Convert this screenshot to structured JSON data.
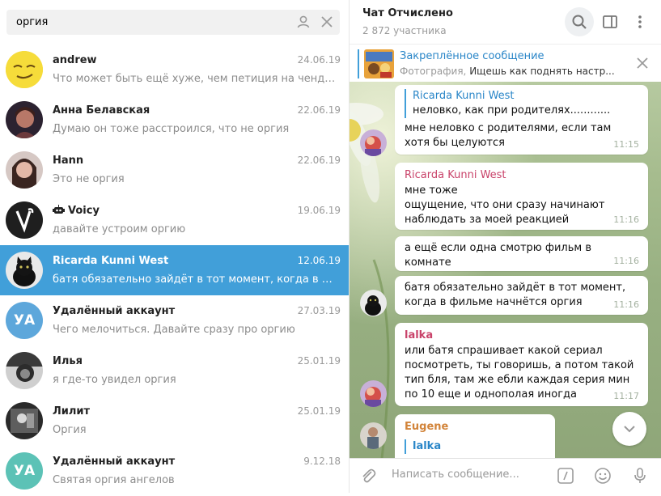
{
  "search": {
    "value": "оргия"
  },
  "chats": [
    {
      "name": "andrew",
      "date": "24.06.19",
      "preview": "Что может быть ещё хуже, чем петиция на чендж .орг)))",
      "avatar_color": "#f2d230",
      "active": false
    },
    {
      "name": "Анна Белавская",
      "date": "22.06.19",
      "preview": "Думаю он тоже расстроился, что не оргия",
      "avatar_color": "#3a2e35",
      "active": false
    },
    {
      "name": "Hann",
      "date": "22.06.19",
      "preview": "Это не оргия",
      "avatar_color": "#a98a86",
      "active": false
    },
    {
      "name": "Voicy",
      "date": "19.06.19",
      "preview": "давайте устроим оргию",
      "avatar_color": "#222222",
      "active": false,
      "bot": true
    },
    {
      "name": "Ricarda Kunni West",
      "date": "12.06.19",
      "preview": "батя обязательно зайдёт в тот момент, когда в фильме начнётся оргия",
      "avatar_color": "#eaeaea",
      "active": true
    },
    {
      "name": "Удалённый аккаунт",
      "date": "27.03.19",
      "preview": "Чего мелочиться. Давайте сразу про оргию",
      "avatar_color": "#5da7db",
      "initials": "УА",
      "active": false
    },
    {
      "name": "Илья",
      "date": "25.01.19",
      "preview": "я где-то увидел оргия",
      "avatar_color": "#5a5a5a",
      "active": false
    },
    {
      "name": "Лилит",
      "date": "25.01.19",
      "preview": "Оргия",
      "avatar_color": "#3c3c3c",
      "active": false
    },
    {
      "name": "Удалённый аккаунт",
      "date": "9.12.18",
      "preview": "Святая оргия ангелов",
      "avatar_color": "#5cc2b6",
      "initials": "УА",
      "active": false
    }
  ],
  "header": {
    "title": "Чат Отчислено",
    "subtitle": "2 872 участника"
  },
  "pinned": {
    "title": "Закреплённое сообщение",
    "prefix": "Фотография,",
    "text": "Ищешь как поднять настр..."
  },
  "messages": {
    "m1": {
      "reply_name": "Ricarda Kunni West",
      "reply_text": "неловко, как при родителях............",
      "text": "мне неловко с родителями, если там хотя бы целуются",
      "time": "11:15"
    },
    "m2": {
      "sender": "Ricarda Kunni West",
      "sender_color": "#c9436a",
      "text": "мне тоже\nощущение, что они сразу начинают наблюдать за моей реакцией",
      "time": "11:16"
    },
    "m3": {
      "text": "а ещё если одна смотрю фильм в комнате",
      "time": "11:16"
    },
    "m4": {
      "text": "батя обязательно зайдёт в тот момент, когда в фильме начнётся оргия",
      "time": "11:16"
    },
    "m5": {
      "sender": "lalka",
      "sender_color": "#c9436a",
      "text": "или батя спрашивает какой сериал посмотреть, ты говоришь, а потом такой тип бля, там же ебли каждая серия мин по 10 еще и однополая иногда",
      "time": "11:17"
    },
    "m6": {
      "sender": "Eugene",
      "sender_color": "#d2843a",
      "reply_name": "lalka"
    }
  },
  "composer": {
    "placeholder": "Написать сообщение..."
  },
  "colors": {
    "accent": "#419fd9",
    "header_link": "#2a86c8"
  }
}
